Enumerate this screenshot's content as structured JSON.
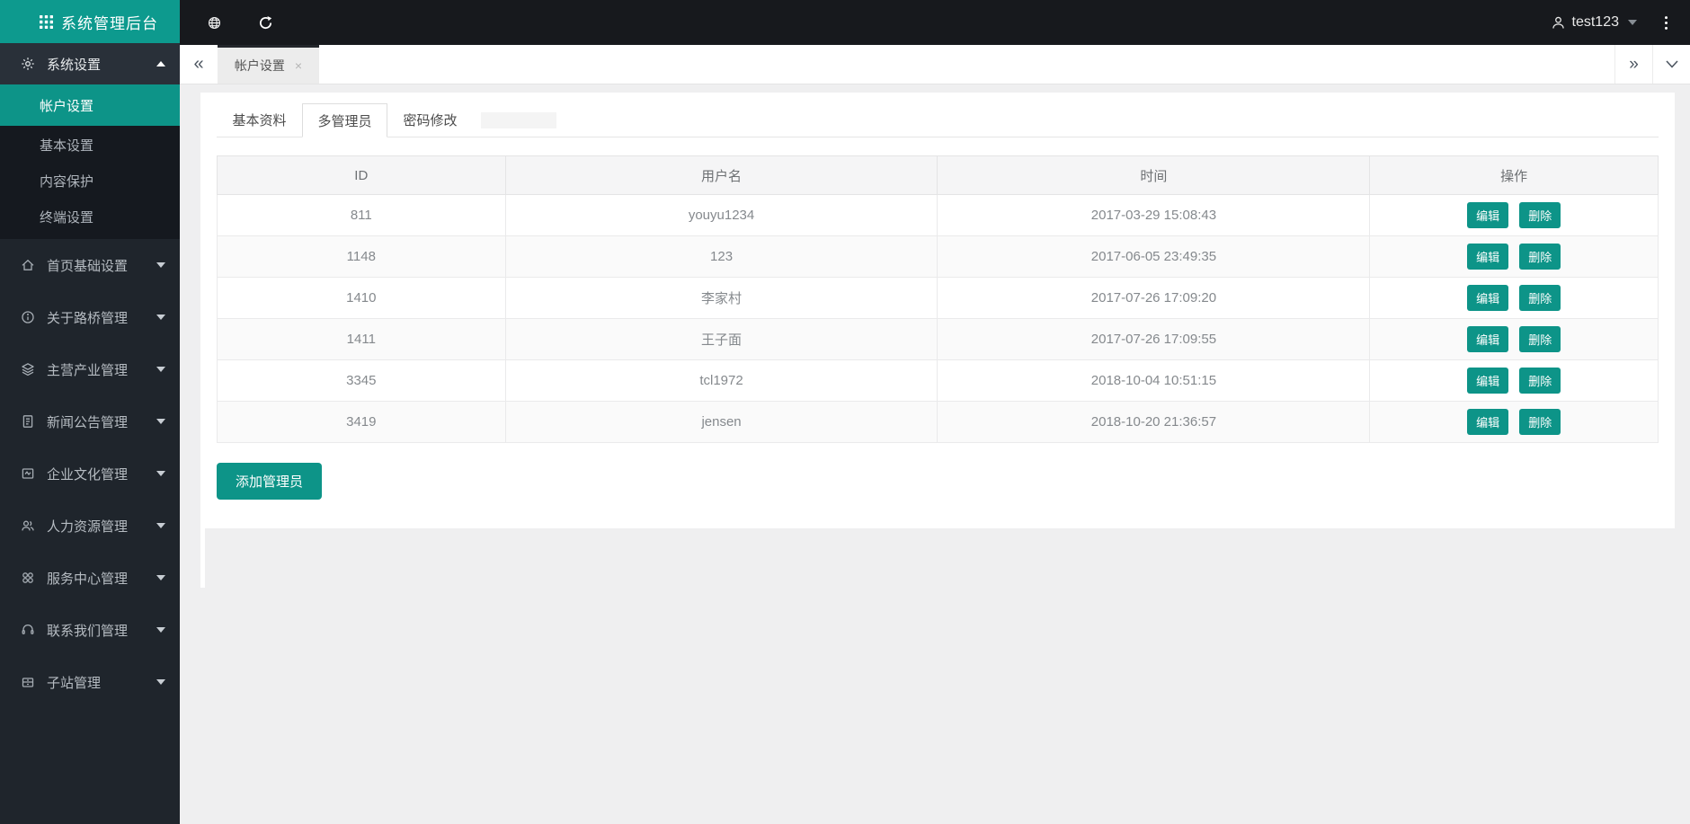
{
  "app": {
    "title": "系统管理后台"
  },
  "colors": {
    "accent": "#0d9488",
    "logo_bg": "#0d9a8e",
    "topbar_bg": "#17191d",
    "sidebar_bg": "#1f252c",
    "sidebar_submenu_bg": "#15191f",
    "content_bg": "#efeff0",
    "tab_top_border": "#23262b",
    "table_header_bg": "#f5f5f6"
  },
  "topbar": {
    "username": "test123",
    "icons": {
      "globe": "globe-icon",
      "refresh": "refresh-icon",
      "user": "user-icon",
      "kebab": "kebab-menu-icon"
    }
  },
  "tabbar": {
    "collapse_glyph": "«",
    "expand_glyph": "»",
    "tab_label": "帐户设置",
    "close_glyph": "×"
  },
  "sidebar": {
    "expanded_group": {
      "label": "系统设置",
      "active_item": "帐户设置",
      "items": [
        "基本设置",
        "内容保护",
        "终端设置"
      ]
    },
    "groups": [
      {
        "label": "首页基础设置",
        "icon": "home-icon"
      },
      {
        "label": "关于路桥管理",
        "icon": "info-icon"
      },
      {
        "label": "主营产业管理",
        "icon": "layers-icon"
      },
      {
        "label": "新闻公告管理",
        "icon": "news-icon"
      },
      {
        "label": "企业文化管理",
        "icon": "picture-icon"
      },
      {
        "label": "人力资源管理",
        "icon": "people-icon"
      },
      {
        "label": "服务中心管理",
        "icon": "service-icon"
      },
      {
        "label": "联系我们管理",
        "icon": "headset-icon"
      },
      {
        "label": "子站管理",
        "icon": "subsite-icon"
      }
    ]
  },
  "main": {
    "tabs": [
      {
        "label": "基本资料",
        "active": false
      },
      {
        "label": "多管理员",
        "active": true
      },
      {
        "label": "密码修改",
        "active": false
      }
    ],
    "table": {
      "headers": [
        "ID",
        "用户名",
        "时间",
        "操作"
      ],
      "actions": {
        "edit": "编辑",
        "delete": "删除"
      },
      "rows": [
        {
          "id": "811",
          "username": "youyu1234",
          "time": "2017-03-29 15:08:43"
        },
        {
          "id": "1148",
          "username": "123",
          "time": "2017-06-05 23:49:35"
        },
        {
          "id": "1410",
          "username": "李家村",
          "time": "2017-07-26 17:09:20"
        },
        {
          "id": "1411",
          "username": "王子面",
          "time": "2017-07-26 17:09:55"
        },
        {
          "id": "3345",
          "username": "tcl1972",
          "time": "2018-10-04 10:51:15"
        },
        {
          "id": "3419",
          "username": "jensen",
          "time": "2018-10-20 21:36:57"
        }
      ]
    },
    "add_button_label": "添加管理员"
  }
}
